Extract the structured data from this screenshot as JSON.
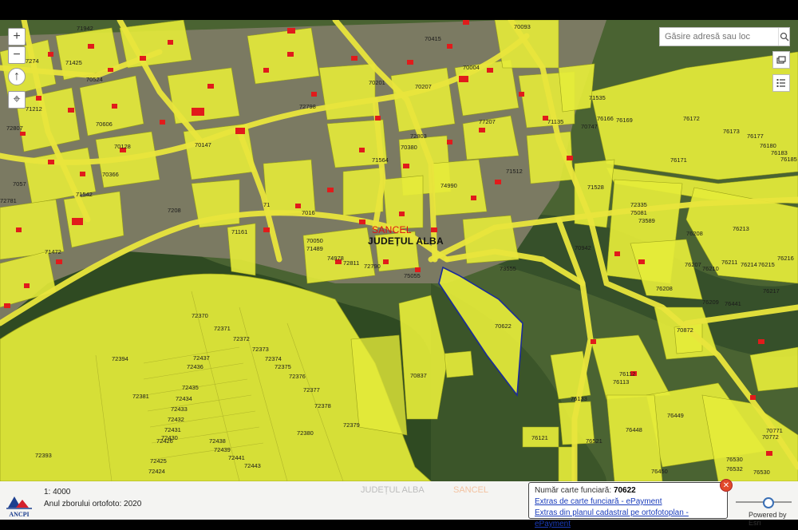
{
  "map": {
    "zoom_in": "+",
    "zoom_out": "−",
    "north": "↑",
    "locate": "⌖",
    "search_placeholder": "Găsire adresă sau loc",
    "locality": "SANCEL",
    "county": "JUDEȚUL ALBA",
    "parcels": [
      "71942",
      "70524",
      "71425",
      "71212",
      "7274",
      "72807",
      "70606",
      "70128",
      "70366",
      "71542",
      "72781",
      "7057",
      "71472",
      "71161",
      "7016",
      "7208",
      "72798",
      "70147",
      "71",
      "70201",
      "70207",
      "70004",
      "70415",
      "70093",
      "71535",
      "76166",
      "76169",
      "76172",
      "76173",
      "76177",
      "76180",
      "76183",
      "76185",
      "70747",
      "71135",
      "77207",
      "70380",
      "72803",
      "71564",
      "74990",
      "71512",
      "71528",
      "75081",
      "73589",
      "72335",
      "76171",
      "76208",
      "76213",
      "76207",
      "76210",
      "76211",
      "76214",
      "76215",
      "76216",
      "76217",
      "76209",
      "76441",
      "76208",
      "70050",
      "71489",
      "74978",
      "72811",
      "72790",
      "75055",
      "73555",
      "70942",
      "70622",
      "70872",
      "76112",
      "76113",
      "76133",
      "76448",
      "76449",
      "76521",
      "76121",
      "76450",
      "76530",
      "76532",
      "76530",
      "70771",
      "70772",
      "72370",
      "72371",
      "72372",
      "72373",
      "72374",
      "72375",
      "72376",
      "72377",
      "72378",
      "72379",
      "72380",
      "72394",
      "72381",
      "72436",
      "72437",
      "72435",
      "72434",
      "72433",
      "72432",
      "72431",
      "72430",
      "72426",
      "72438",
      "72439",
      "72441",
      "72443",
      "72425",
      "72424",
      "72393",
      "70837"
    ],
    "icons": [
      "basemap-icon",
      "layers-icon"
    ]
  },
  "status": {
    "scale": "1: 4000",
    "year": "Anul zborului ortofoto: 2020",
    "faint_county": "JUDEȚUL ALBA",
    "faint_locality": "SANCEL",
    "logo": "ANCPI"
  },
  "popup": {
    "label": "Număr carte funciară:",
    "number": "70622",
    "link1": "Extras de carte funciară - ePayment",
    "link2": "Extras din planul cadastral pe ortofotoplan - ePayment"
  },
  "footer": {
    "powered": "Powered by Esri"
  },
  "colors": {
    "parcel": "#e5eb3a",
    "road": "#e9e53c",
    "building": "#e11b1b",
    "selection": "#1a2b9a",
    "vegetation": "#2f4a22"
  }
}
